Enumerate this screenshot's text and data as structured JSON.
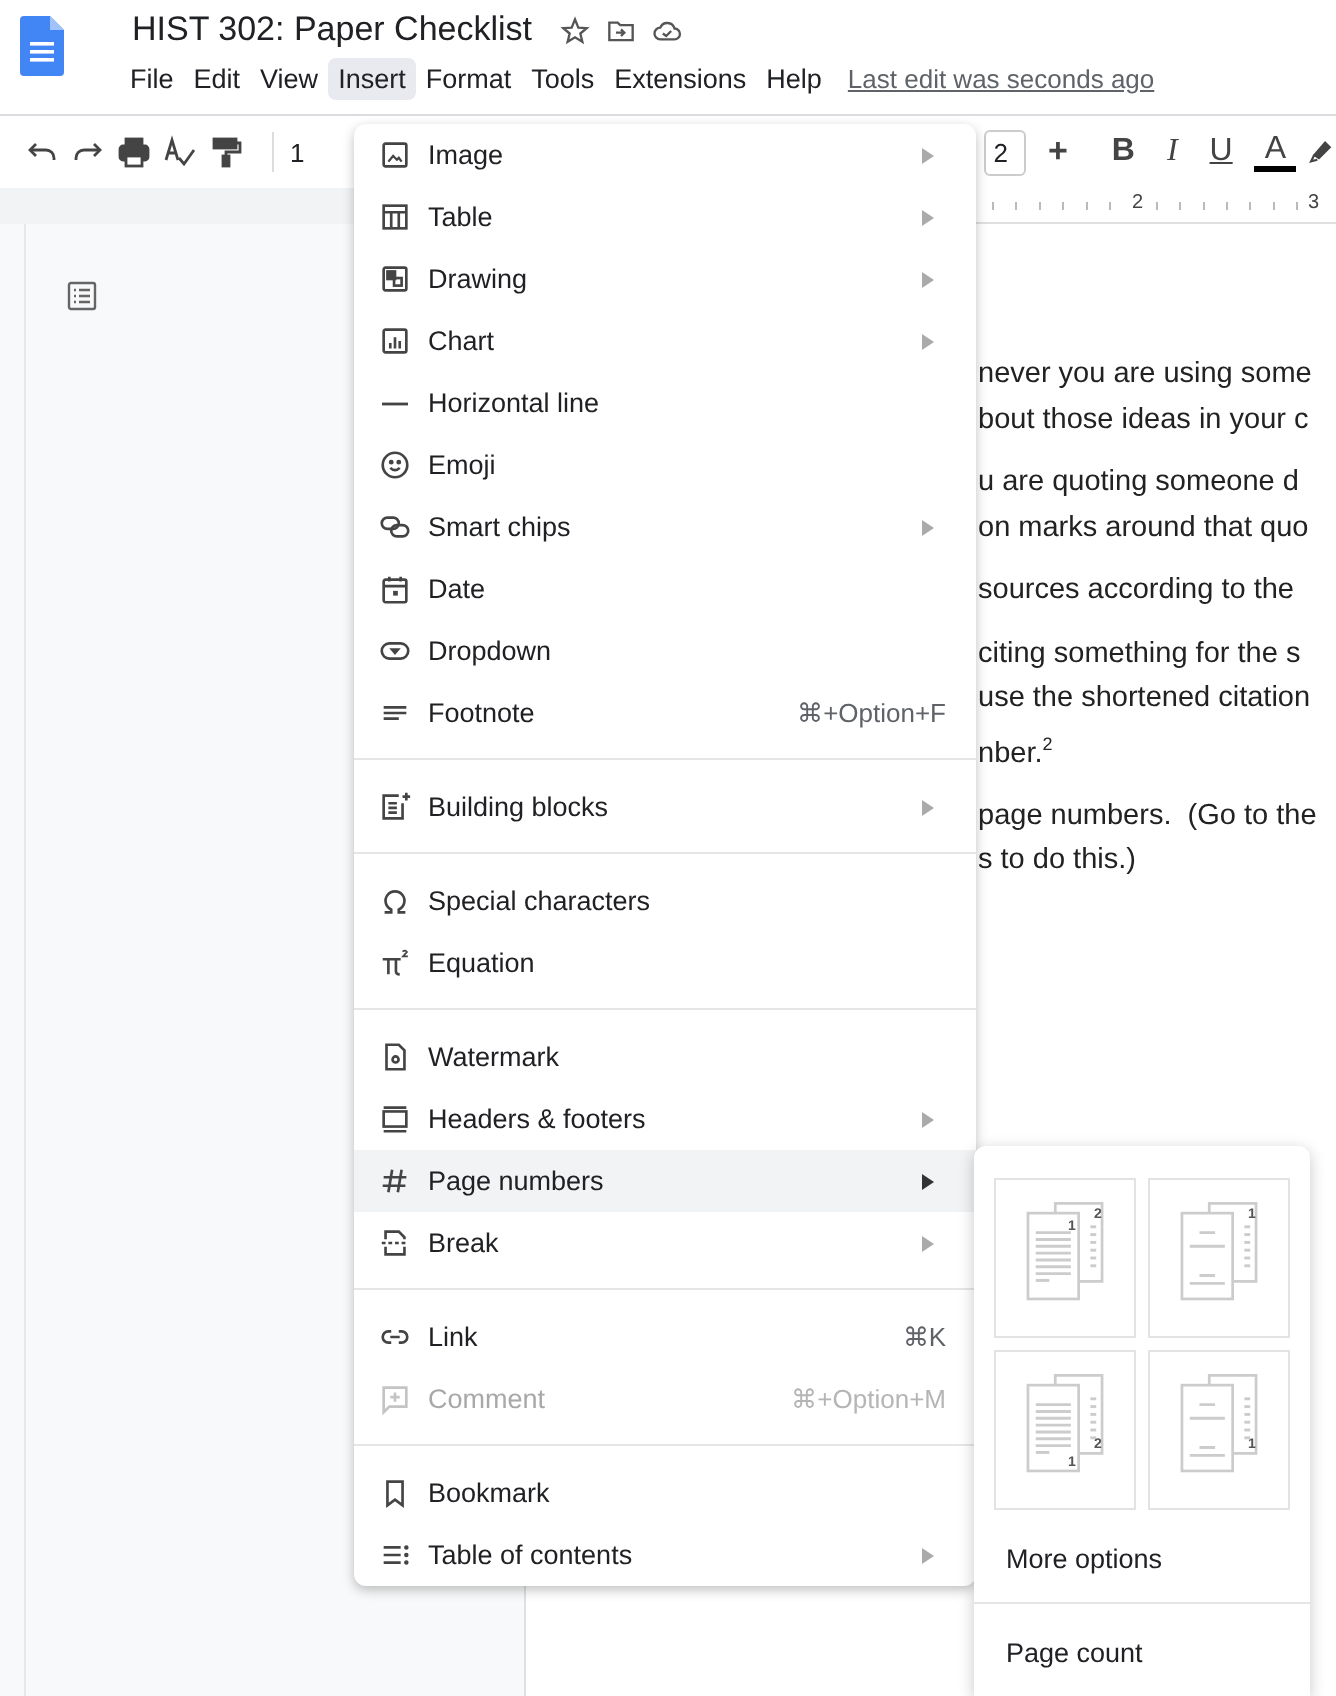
{
  "document": {
    "title": "HIST 302: Paper Checklist",
    "status": "Last edit was seconds ago"
  },
  "menu_bar": [
    {
      "label": "File",
      "selected": false
    },
    {
      "label": "Edit",
      "selected": false
    },
    {
      "label": "View",
      "selected": false
    },
    {
      "label": "Insert",
      "selected": true
    },
    {
      "label": "Format",
      "selected": false
    },
    {
      "label": "Tools",
      "selected": false
    },
    {
      "label": "Extensions",
      "selected": false
    },
    {
      "label": "Help",
      "selected": false
    }
  ],
  "toolbar": {
    "zoom": "1",
    "font_size": "2",
    "increase": "+",
    "format_buttons": [
      {
        "kind": "bold",
        "label": "B"
      },
      {
        "kind": "italic",
        "label": "I"
      },
      {
        "kind": "underline",
        "label": "U"
      },
      {
        "kind": "text-color",
        "label": "A"
      }
    ]
  },
  "ruler": {
    "marks": [
      "2",
      "3"
    ]
  },
  "page_text": [
    [
      "never you are using some",
      "bout those ideas in your c"
    ],
    [
      "u are quoting someone d",
      "on marks around that quo"
    ],
    [
      "sources according to the"
    ],
    [
      "citing something for the s",
      "use the shortened citation",
      "nber.$^{2}$"
    ],
    [
      "page numbers.  (Go to the",
      "s to do this.)"
    ]
  ],
  "insert_menu": {
    "items": [
      {
        "kind": "item",
        "label": "Image",
        "submenu": true,
        "selected": false,
        "disabled": false
      },
      {
        "kind": "item",
        "label": "Table",
        "submenu": true,
        "selected": false,
        "disabled": false
      },
      {
        "kind": "item",
        "label": "Drawing",
        "submenu": true,
        "selected": false,
        "disabled": false
      },
      {
        "kind": "item",
        "label": "Chart",
        "submenu": true,
        "selected": false,
        "disabled": false
      },
      {
        "kind": "item",
        "label": "Horizontal line",
        "submenu": false,
        "selected": false,
        "disabled": false
      },
      {
        "kind": "item",
        "label": "Emoji",
        "submenu": false,
        "selected": false,
        "disabled": false
      },
      {
        "kind": "item",
        "label": "Smart chips",
        "submenu": true,
        "selected": false,
        "disabled": false
      },
      {
        "kind": "item",
        "label": "Date",
        "submenu": false,
        "selected": false,
        "disabled": false
      },
      {
        "kind": "item",
        "label": "Dropdown",
        "submenu": false,
        "selected": false,
        "disabled": false
      },
      {
        "kind": "item",
        "label": "Footnote",
        "shortcut": "⌘+Option+F",
        "submenu": false,
        "selected": false,
        "disabled": false
      },
      {
        "kind": "divider"
      },
      {
        "kind": "item",
        "label": "Building blocks",
        "submenu": true,
        "selected": false,
        "disabled": false
      },
      {
        "kind": "divider"
      },
      {
        "kind": "item",
        "label": "Special characters",
        "submenu": false,
        "selected": false,
        "disabled": false
      },
      {
        "kind": "item",
        "label": "Equation",
        "submenu": false,
        "selected": false,
        "disabled": false
      },
      {
        "kind": "divider"
      },
      {
        "kind": "item",
        "label": "Watermark",
        "submenu": false,
        "selected": false,
        "disabled": false
      },
      {
        "kind": "item",
        "label": "Headers & footers",
        "submenu": true,
        "selected": false,
        "disabled": false
      },
      {
        "kind": "item",
        "label": "Page numbers",
        "submenu": true,
        "selected": true,
        "disabled": false
      },
      {
        "kind": "item",
        "label": "Break",
        "submenu": true,
        "selected": false,
        "disabled": false
      },
      {
        "kind": "divider"
      },
      {
        "kind": "item",
        "label": "Link",
        "shortcut": "⌘K",
        "submenu": false,
        "selected": false,
        "disabled": false
      },
      {
        "kind": "item",
        "label": "Comment",
        "shortcut": "⌘+Option+M",
        "submenu": false,
        "selected": false,
        "disabled": true
      },
      {
        "kind": "divider"
      },
      {
        "kind": "item",
        "label": "Bookmark",
        "submenu": false,
        "selected": false,
        "disabled": false
      },
      {
        "kind": "item",
        "label": "Table of contents",
        "submenu": true,
        "selected": false,
        "disabled": false
      }
    ]
  },
  "page_numbers_submenu": {
    "layouts": [
      {
        "kind": "header",
        "front_number": "1",
        "back_number": "2"
      },
      {
        "kind": "header",
        "back_number": "1"
      },
      {
        "kind": "footer",
        "front_number": "1",
        "back_number": "2"
      },
      {
        "kind": "footer",
        "back_number": "1"
      }
    ],
    "options": [
      "More options",
      "Page count"
    ]
  }
}
